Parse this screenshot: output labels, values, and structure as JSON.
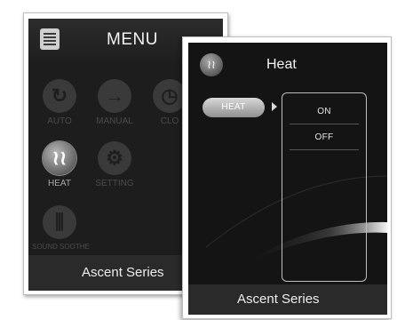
{
  "menu_screen": {
    "title": "MENU",
    "menu_icon": "list-menu-icon",
    "tiles": [
      {
        "label": "AUTO",
        "icon": "auto-cycle-icon",
        "active": false
      },
      {
        "label": "MANUAL",
        "icon": "arrow-right-icon",
        "active": false
      },
      {
        "label": "CLO",
        "icon": "clock-icon",
        "active": false
      },
      {
        "label": "HEAT",
        "icon": "heat-waves-icon",
        "active": true
      },
      {
        "label": "SETTING",
        "icon": "gear-icon",
        "active": false
      },
      {
        "label": "SOUND SOOTHE",
        "icon": "sound-wave-icon",
        "active": false
      }
    ],
    "footer": "Ascent Series"
  },
  "heat_screen": {
    "title": "Heat",
    "icon": "heat-waves-icon",
    "selected_item": "HEAT",
    "options": [
      "ON",
      "OFF"
    ],
    "footer": "Ascent Series"
  },
  "colors": {
    "screen_bg": "#1d1d1d",
    "active_tile": "#8a8a8a",
    "frame": "#ffffff"
  }
}
